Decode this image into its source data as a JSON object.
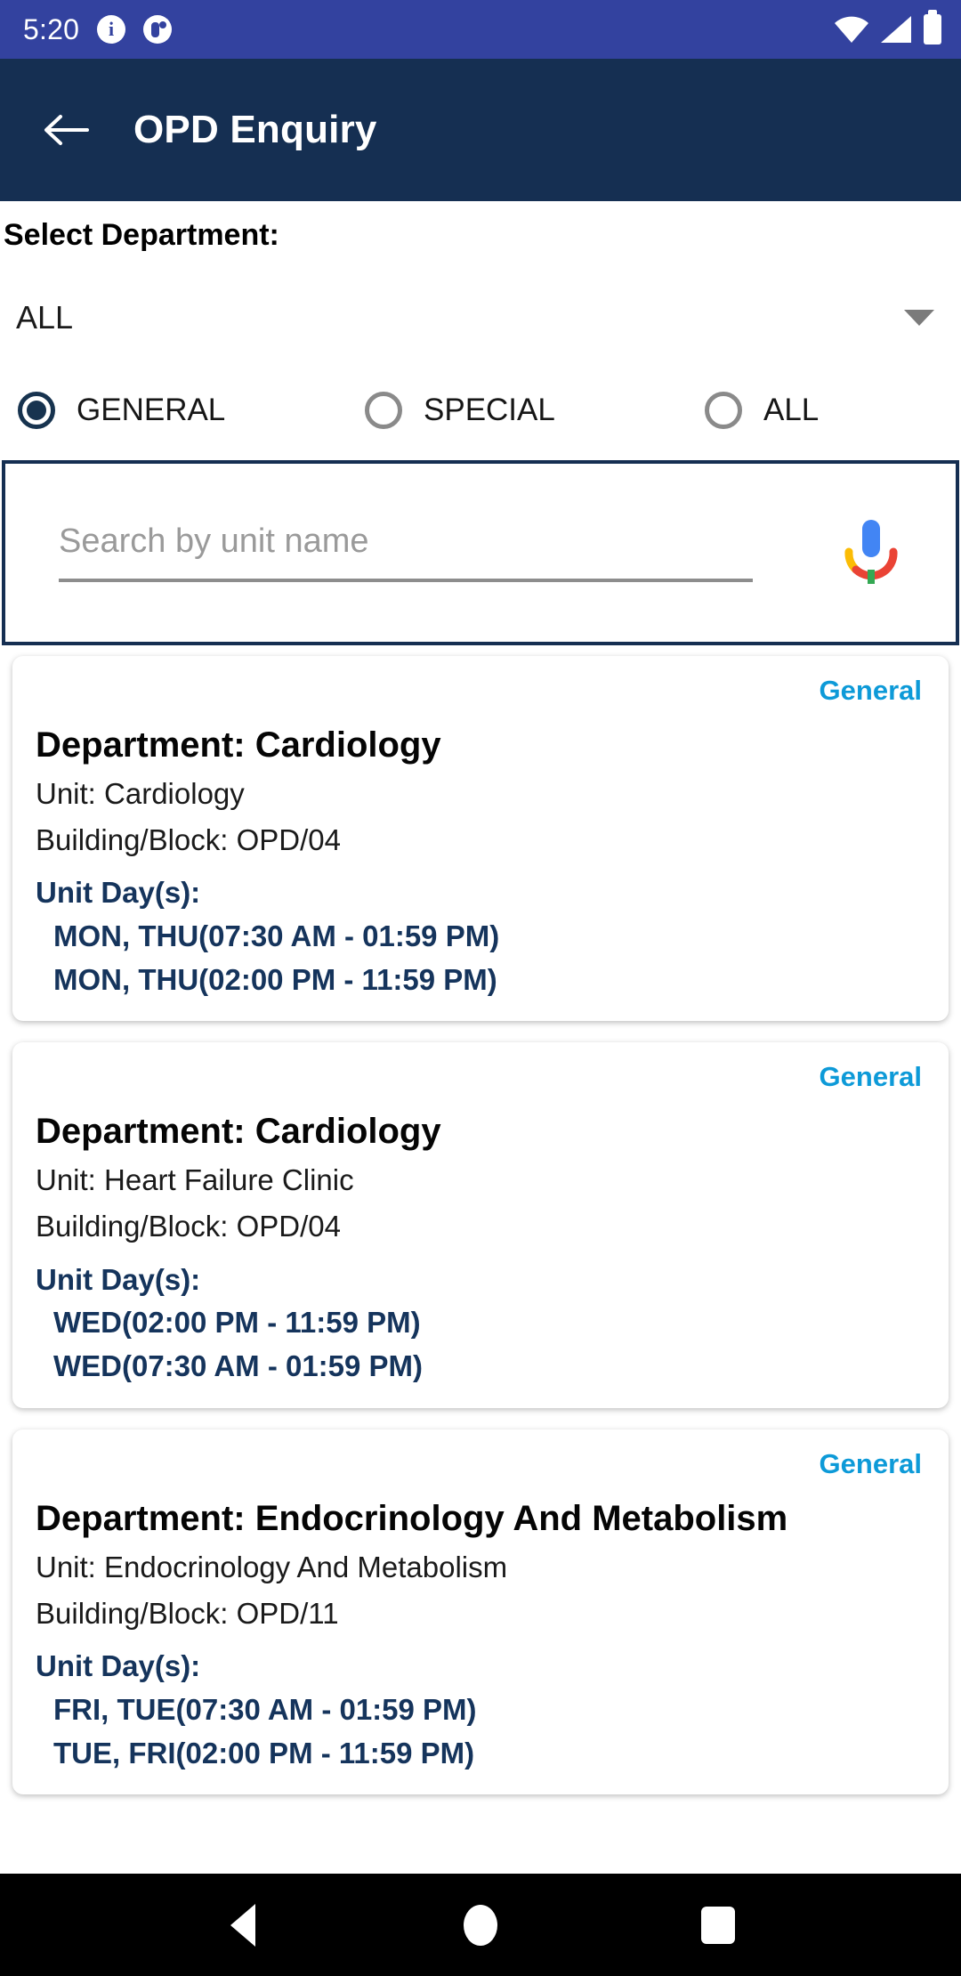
{
  "status_bar": {
    "time": "5:20",
    "icons": [
      "info-icon",
      "app-notification-icon",
      "wifi-icon",
      "signal-icon",
      "battery-icon"
    ]
  },
  "app_bar": {
    "back_label": "back-arrow",
    "title": "OPD Enquiry"
  },
  "form": {
    "department_label": "Select Department:",
    "department_value": "ALL",
    "radio_options": [
      {
        "label": "GENERAL",
        "selected": true
      },
      {
        "label": "SPECIAL",
        "selected": false
      },
      {
        "label": "ALL",
        "selected": false
      }
    ]
  },
  "search": {
    "placeholder": "Search by unit name",
    "value": "",
    "mic_icon": "google-microphone-icon"
  },
  "cards": [
    {
      "badge": "General",
      "department": "Department: Cardiology",
      "unit": "Unit: Cardiology",
      "building": "Building/Block:  OPD/04",
      "days_label": "Unit Day(s):",
      "days": [
        "MON, THU(07:30 AM - 01:59 PM)",
        "MON, THU(02:00 PM - 11:59 PM)"
      ]
    },
    {
      "badge": "General",
      "department": "Department: Cardiology",
      "unit": "Unit: Heart Failure Clinic",
      "building": "Building/Block:  OPD/04",
      "days_label": "Unit Day(s):",
      "days": [
        "WED(02:00 PM - 11:59 PM)",
        "WED(07:30 AM - 01:59 PM)"
      ]
    },
    {
      "badge": "General",
      "department": "Department: Endocrinology And Metabolism",
      "unit": "Unit: Endocrinology And Metabolism",
      "building": "Building/Block:  OPD/11",
      "days_label": "Unit Day(s):",
      "days": [
        "FRI, TUE(07:30 AM - 01:59 PM)",
        "TUE, FRI(02:00 PM - 11:59 PM)"
      ]
    }
  ],
  "nav_bar": {
    "back": "back-triangle-icon",
    "home": "home-circle-icon",
    "recents": "recents-square-icon"
  },
  "colors": {
    "status_bar": "#33429f",
    "app_bar": "#152f52",
    "badge": "#0d9ad8",
    "days_text": "#15345c",
    "radio_selected": "#17334f"
  }
}
